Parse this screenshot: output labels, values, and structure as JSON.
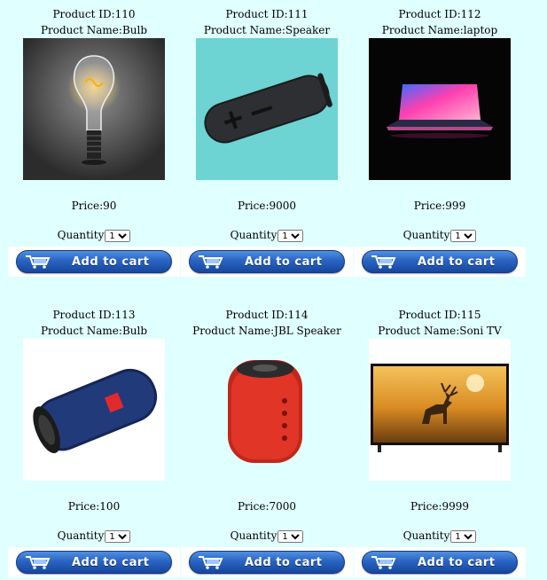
{
  "products": [
    {
      "id_label": "Product ID:110",
      "name_label": "Product Name:Bulb",
      "price_label": "Price:90",
      "quantity_label": "Quantity",
      "quantity_value": "1",
      "cart_label": "Add to cart",
      "image": "light-bulb-image"
    },
    {
      "id_label": "Product ID:111",
      "name_label": "Product Name:Speaker",
      "price_label": "Price:9000",
      "quantity_label": "Quantity",
      "quantity_value": "1",
      "cart_label": "Add to cart",
      "image": "cylinder-speaker-image"
    },
    {
      "id_label": "Product ID:112",
      "name_label": "Product Name:laptop",
      "price_label": "Price:999",
      "quantity_label": "Quantity",
      "quantity_value": "1",
      "cart_label": "Add to cart",
      "image": "laptop-image"
    },
    {
      "id_label": "Product ID:113",
      "name_label": "Product Name:Bulb",
      "price_label": "Price:100",
      "quantity_label": "Quantity",
      "quantity_value": "1",
      "cart_label": "Add to cart",
      "image": "jbl-blue-speaker-image"
    },
    {
      "id_label": "Product ID:114",
      "name_label": "Product Name:JBL Speaker",
      "price_label": "Price:7000",
      "quantity_label": "Quantity",
      "quantity_value": "1",
      "cart_label": "Add to cart",
      "image": "red-speaker-image"
    },
    {
      "id_label": "Product ID:115",
      "name_label": "Product Name:Soni TV",
      "price_label": "Price:9999",
      "quantity_label": "Quantity",
      "quantity_value": "1",
      "cart_label": "Add to cart",
      "image": "tv-deer-image"
    }
  ],
  "colors": {
    "page_bg": "#e0ffff",
    "button_blue": "#2a64c3",
    "cart_panel": "#ffffff"
  }
}
